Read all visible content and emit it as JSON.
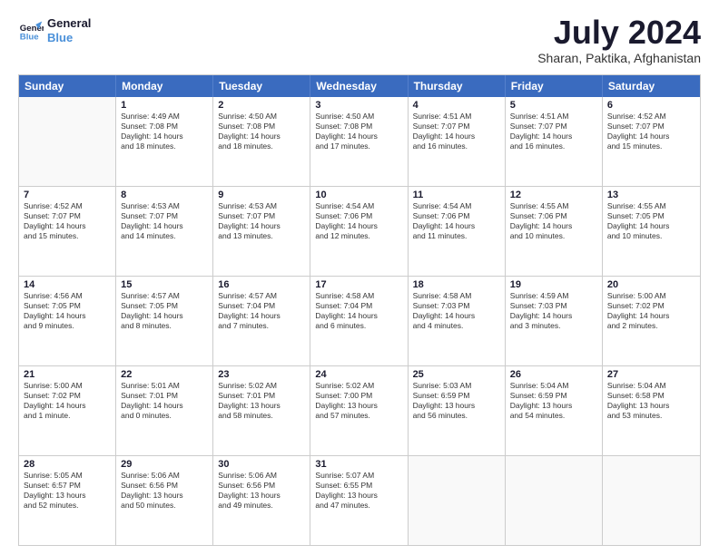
{
  "logo": {
    "line1": "General",
    "line2": "Blue"
  },
  "title": "July 2024",
  "location": "Sharan, Paktika, Afghanistan",
  "header_days": [
    "Sunday",
    "Monday",
    "Tuesday",
    "Wednesday",
    "Thursday",
    "Friday",
    "Saturday"
  ],
  "weeks": [
    [
      {
        "day": "",
        "text": ""
      },
      {
        "day": "1",
        "text": "Sunrise: 4:49 AM\nSunset: 7:08 PM\nDaylight: 14 hours\nand 18 minutes."
      },
      {
        "day": "2",
        "text": "Sunrise: 4:50 AM\nSunset: 7:08 PM\nDaylight: 14 hours\nand 18 minutes."
      },
      {
        "day": "3",
        "text": "Sunrise: 4:50 AM\nSunset: 7:08 PM\nDaylight: 14 hours\nand 17 minutes."
      },
      {
        "day": "4",
        "text": "Sunrise: 4:51 AM\nSunset: 7:07 PM\nDaylight: 14 hours\nand 16 minutes."
      },
      {
        "day": "5",
        "text": "Sunrise: 4:51 AM\nSunset: 7:07 PM\nDaylight: 14 hours\nand 16 minutes."
      },
      {
        "day": "6",
        "text": "Sunrise: 4:52 AM\nSunset: 7:07 PM\nDaylight: 14 hours\nand 15 minutes."
      }
    ],
    [
      {
        "day": "7",
        "text": "Sunrise: 4:52 AM\nSunset: 7:07 PM\nDaylight: 14 hours\nand 15 minutes."
      },
      {
        "day": "8",
        "text": "Sunrise: 4:53 AM\nSunset: 7:07 PM\nDaylight: 14 hours\nand 14 minutes."
      },
      {
        "day": "9",
        "text": "Sunrise: 4:53 AM\nSunset: 7:07 PM\nDaylight: 14 hours\nand 13 minutes."
      },
      {
        "day": "10",
        "text": "Sunrise: 4:54 AM\nSunset: 7:06 PM\nDaylight: 14 hours\nand 12 minutes."
      },
      {
        "day": "11",
        "text": "Sunrise: 4:54 AM\nSunset: 7:06 PM\nDaylight: 14 hours\nand 11 minutes."
      },
      {
        "day": "12",
        "text": "Sunrise: 4:55 AM\nSunset: 7:06 PM\nDaylight: 14 hours\nand 10 minutes."
      },
      {
        "day": "13",
        "text": "Sunrise: 4:55 AM\nSunset: 7:05 PM\nDaylight: 14 hours\nand 10 minutes."
      }
    ],
    [
      {
        "day": "14",
        "text": "Sunrise: 4:56 AM\nSunset: 7:05 PM\nDaylight: 14 hours\nand 9 minutes."
      },
      {
        "day": "15",
        "text": "Sunrise: 4:57 AM\nSunset: 7:05 PM\nDaylight: 14 hours\nand 8 minutes."
      },
      {
        "day": "16",
        "text": "Sunrise: 4:57 AM\nSunset: 7:04 PM\nDaylight: 14 hours\nand 7 minutes."
      },
      {
        "day": "17",
        "text": "Sunrise: 4:58 AM\nSunset: 7:04 PM\nDaylight: 14 hours\nand 6 minutes."
      },
      {
        "day": "18",
        "text": "Sunrise: 4:58 AM\nSunset: 7:03 PM\nDaylight: 14 hours\nand 4 minutes."
      },
      {
        "day": "19",
        "text": "Sunrise: 4:59 AM\nSunset: 7:03 PM\nDaylight: 14 hours\nand 3 minutes."
      },
      {
        "day": "20",
        "text": "Sunrise: 5:00 AM\nSunset: 7:02 PM\nDaylight: 14 hours\nand 2 minutes."
      }
    ],
    [
      {
        "day": "21",
        "text": "Sunrise: 5:00 AM\nSunset: 7:02 PM\nDaylight: 14 hours\nand 1 minute."
      },
      {
        "day": "22",
        "text": "Sunrise: 5:01 AM\nSunset: 7:01 PM\nDaylight: 14 hours\nand 0 minutes."
      },
      {
        "day": "23",
        "text": "Sunrise: 5:02 AM\nSunset: 7:01 PM\nDaylight: 13 hours\nand 58 minutes."
      },
      {
        "day": "24",
        "text": "Sunrise: 5:02 AM\nSunset: 7:00 PM\nDaylight: 13 hours\nand 57 minutes."
      },
      {
        "day": "25",
        "text": "Sunrise: 5:03 AM\nSunset: 6:59 PM\nDaylight: 13 hours\nand 56 minutes."
      },
      {
        "day": "26",
        "text": "Sunrise: 5:04 AM\nSunset: 6:59 PM\nDaylight: 13 hours\nand 54 minutes."
      },
      {
        "day": "27",
        "text": "Sunrise: 5:04 AM\nSunset: 6:58 PM\nDaylight: 13 hours\nand 53 minutes."
      }
    ],
    [
      {
        "day": "28",
        "text": "Sunrise: 5:05 AM\nSunset: 6:57 PM\nDaylight: 13 hours\nand 52 minutes."
      },
      {
        "day": "29",
        "text": "Sunrise: 5:06 AM\nSunset: 6:56 PM\nDaylight: 13 hours\nand 50 minutes."
      },
      {
        "day": "30",
        "text": "Sunrise: 5:06 AM\nSunset: 6:56 PM\nDaylight: 13 hours\nand 49 minutes."
      },
      {
        "day": "31",
        "text": "Sunrise: 5:07 AM\nSunset: 6:55 PM\nDaylight: 13 hours\nand 47 minutes."
      },
      {
        "day": "",
        "text": ""
      },
      {
        "day": "",
        "text": ""
      },
      {
        "day": "",
        "text": ""
      }
    ]
  ]
}
